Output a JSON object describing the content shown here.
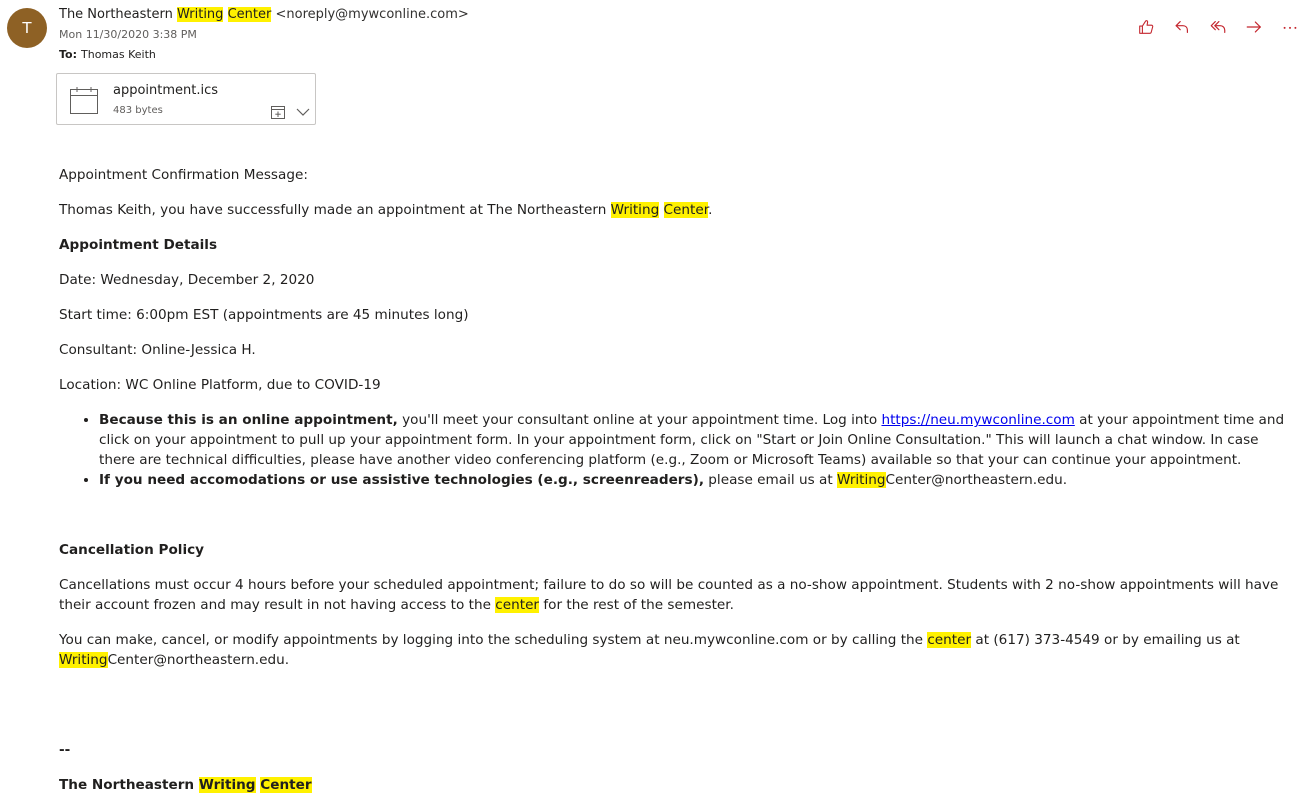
{
  "header": {
    "avatar_initial": "T",
    "avatar_color": "#8e6125",
    "sender_pre": "The Northeastern ",
    "sender_hl1": "Writing",
    "sender_hl2": "Center",
    "sender_email": "<noreply@mywconline.com>",
    "date": "Mon 11/30/2020 3:38 PM",
    "to_label": "To:",
    "to_name": "Thomas Keith"
  },
  "actions": [
    {
      "name": "like-button",
      "icon": "thumbs-up-icon"
    },
    {
      "name": "reply-button",
      "icon": "reply-icon"
    },
    {
      "name": "reply-all-button",
      "icon": "reply-all-icon"
    },
    {
      "name": "forward-button",
      "icon": "forward-icon"
    },
    {
      "name": "more-actions-button",
      "icon": "more-icon"
    }
  ],
  "attachment": {
    "filename": "appointment.ics",
    "size": "483 bytes"
  },
  "body": {
    "intro": "Appointment Confirmation Message:",
    "greeting_pre": "Thomas Keith, you have successfully made an appointment at The Northeastern ",
    "greeting_hl1": "Writing",
    "greeting_hl2": "Center",
    "greeting_post": ".",
    "details_heading": "Appointment Details",
    "date": "Date: Wednesday, December 2, 2020",
    "start_time": "Start time: 6:00pm EST (appointments are 45 minutes long)",
    "consultant": "Consultant: Online-Jessica H.",
    "location": "Location: WC Online Platform, due to COVID-19",
    "bullet1_bold": "Because this is an online appointment,",
    "bullet1_pre": " you'll meet your consultant online at your appointment time. Log into ",
    "bullet1_link": "https://neu.mywconline.com",
    "bullet1_post": " at your appointment time and click on your appointment to pull up your appointment form. In your appointment form, click on \"Start or Join Online Consultation.\" This will launch a chat window. In case there are technical difficulties, please have another video conferencing platform (e.g., Zoom or Microsoft Teams) available so that your can continue your appointment.",
    "bullet2_bold": "If you need accomodations or use assistive technologies (e.g., screenreaders),",
    "bullet2_pre": " please email us at ",
    "bullet2_hl": "Writing",
    "bullet2_post": "Center@northeastern.edu.",
    "cancel_heading": "Cancellation Policy",
    "cancel_pre": "Cancellations must occur 4 hours before your scheduled appointment; failure to do so will be counted as a no-show appointment. Students with 2 no-show appointments will have their account frozen and may result in not having access to the ",
    "cancel_hl": "center",
    "cancel_post": " for the rest of the semester.",
    "modify_pre": "You can make, cancel, or modify appointments by logging into the scheduling system at neu.mywconline.com or by calling the ",
    "modify_hl1": "center",
    "modify_mid": " at (617) 373-4549 or by emailing us at ",
    "modify_hl2": "Writing",
    "modify_post": "Center@northeastern.edu.",
    "sig_dash": "--",
    "sig_pre": "The Northeastern ",
    "sig_hl1": "Writing",
    "sig_hl2": "Center"
  },
  "colors": {
    "accent": "#c4262e",
    "highlight": "#fff100",
    "link": "#0000ee"
  }
}
